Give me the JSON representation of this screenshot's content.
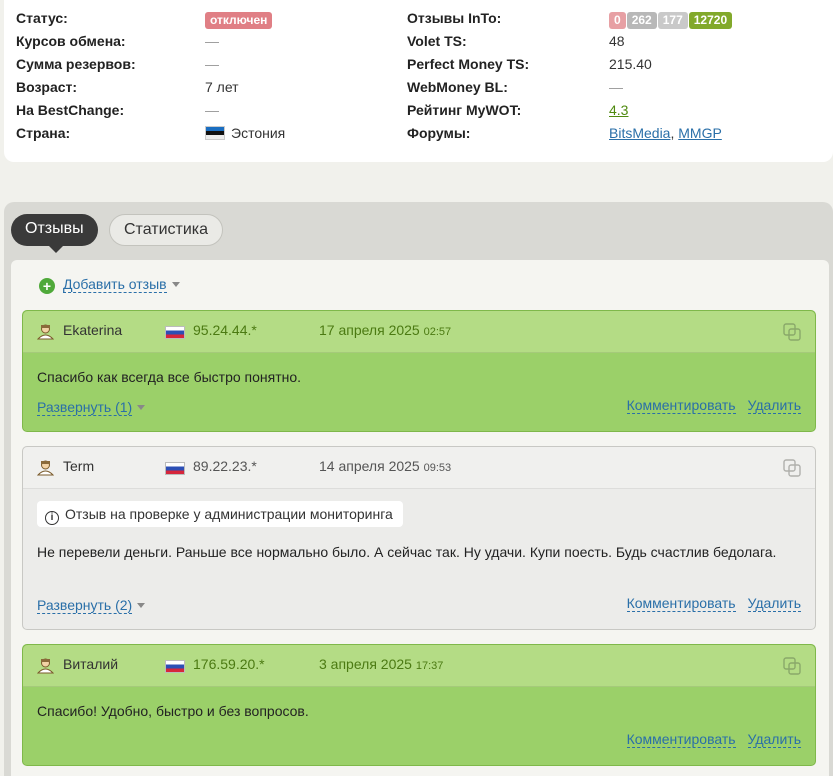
{
  "info": {
    "left": [
      {
        "label": "Статус:",
        "value": "отключен",
        "kind": "badge"
      },
      {
        "label": "Курсов обмена:",
        "value": "—",
        "kind": "dash"
      },
      {
        "label": "Сумма резервов:",
        "value": "—",
        "kind": "dash"
      },
      {
        "label": "Возраст:",
        "value": "7 лет",
        "kind": "text"
      },
      {
        "label": "На BestChange:",
        "value": "—",
        "kind": "dash"
      },
      {
        "label": "Страна:",
        "value": "Эстония",
        "kind": "country"
      }
    ],
    "right": [
      {
        "label": "Отзывы InTo:",
        "counts": [
          "0",
          "262",
          "177",
          "12720"
        ]
      },
      {
        "label": "Volet TS:",
        "value": "48"
      },
      {
        "label": "Perfect Money TS:",
        "value": "215.40"
      },
      {
        "label": "WebMoney BL:",
        "value": "—"
      },
      {
        "label": "Рейтинг MyWOT:",
        "value": "4.3"
      },
      {
        "label": "Форумы:",
        "forums": [
          "BitsMedia",
          "MMGP"
        ],
        "separator": ","
      }
    ]
  },
  "tabs": {
    "reviews": "Отзывы",
    "stats": "Статистика"
  },
  "add_review": "Добавить отзыв",
  "reviews": [
    {
      "style": "green",
      "user": "Ekaterina",
      "ip": "95.24.44.*",
      "date": "17 апреля 2025",
      "time": "02:57",
      "notice": "",
      "text": "Спасибо как всегда все быстро понятно.",
      "expand": "Развернуть (1)",
      "comment": "Комментировать",
      "delete": "Удалить"
    },
    {
      "style": "gray",
      "user": "Term",
      "ip": "89.22.23.*",
      "date": "14 апреля 2025",
      "time": "09:53",
      "notice": "Отзыв на проверке у администрации мониторинга",
      "text": "Не перевели деньги. Раньше все нормально было. А сейчас так. Ну удачи. Купи поесть. Будь счастлив бедолага.",
      "expand": "Развернуть (2)",
      "comment": "Комментировать",
      "delete": "Удалить"
    },
    {
      "style": "green",
      "user": "Виталий",
      "ip": "176.59.20.*",
      "date": "3 апреля 2025",
      "time": "17:37",
      "notice": "",
      "text": "Спасибо! Удобно, быстро и без вопросов.",
      "expand": "",
      "comment": "Комментировать",
      "delete": "Удалить"
    }
  ]
}
